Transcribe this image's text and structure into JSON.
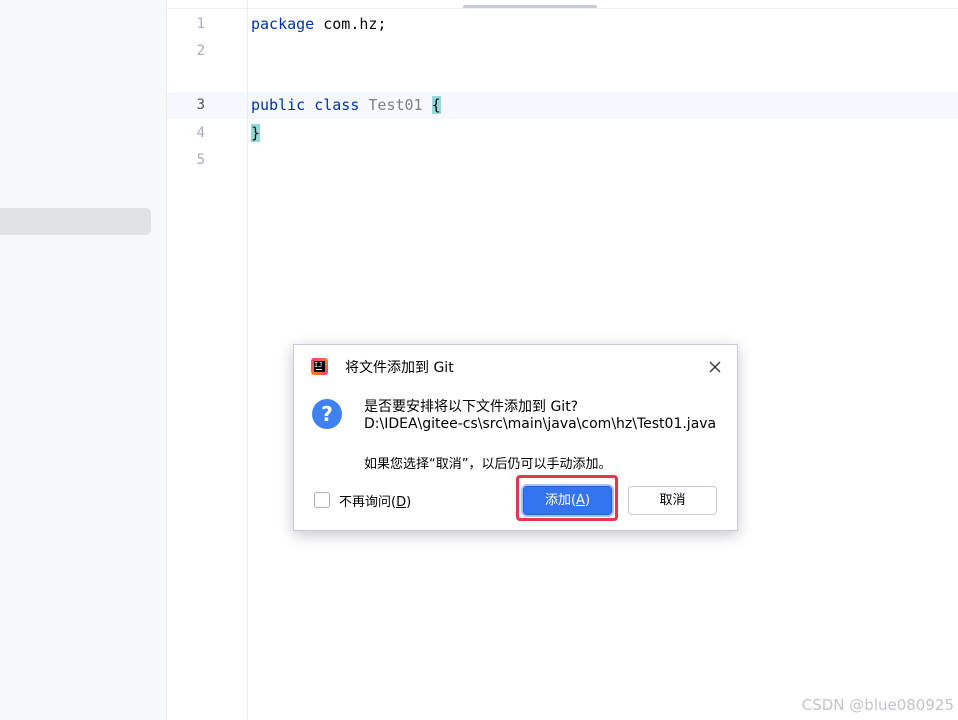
{
  "editor": {
    "line_numbers": [
      "1",
      "2",
      "3",
      "4",
      "5"
    ],
    "lines": {
      "l1": {
        "kw": "package",
        "rest": " com.hz;"
      },
      "l3": {
        "kw1": "public",
        "kw2": "class",
        "cls": "Test01",
        "brace": "{"
      },
      "l4": {
        "brace": "}"
      }
    }
  },
  "dialog": {
    "title": "将文件添加到 Git",
    "question_glyph": "?",
    "message_line1": "是否要安排将以下文件添加到 Git?",
    "file_path": "D:\\IDEA\\gitee-cs\\src\\main\\java\\com\\hz\\Test01.java",
    "note": "如果您选择“取消”，以后仍可以手动添加。",
    "dont_ask": {
      "label_prefix": "不再询问(",
      "mnemonic": "D",
      "label_suffix": ")",
      "checked": false
    },
    "add_button": {
      "prefix": "添加(",
      "mnemonic": "A",
      "suffix": ")"
    },
    "cancel_label": "取消"
  },
  "watermark": "CSDN @blue080925",
  "colors": {
    "keyword": "#0033b3",
    "class_name": "#808080",
    "brace_match": "#93d9d9",
    "primary_button": "#3574f0",
    "question_icon": "#3f81f1",
    "highlight_frame": "#e8344f"
  },
  "icons": [
    "intellij-logo-icon",
    "close-icon",
    "question-icon",
    "checkbox-icon"
  ]
}
